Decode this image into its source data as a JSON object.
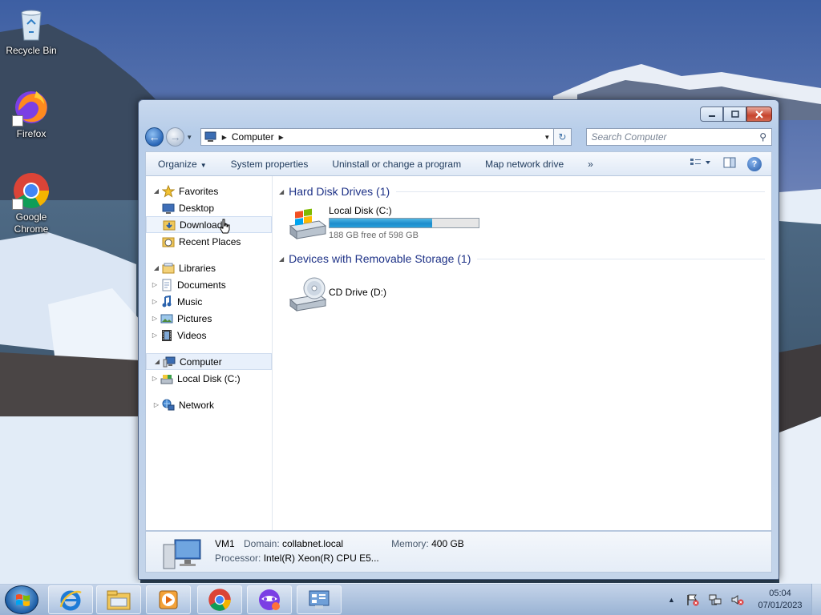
{
  "desktop": {
    "icons": [
      {
        "label": "Recycle Bin",
        "icon": "recycle-bin-icon"
      },
      {
        "label": "Firefox",
        "icon": "firefox-icon"
      },
      {
        "label": "Google Chrome",
        "icon": "chrome-icon"
      }
    ]
  },
  "window": {
    "address": {
      "location": "Computer"
    },
    "search": {
      "placeholder": "Search Computer"
    },
    "commands": {
      "organize": "Organize",
      "system_properties": "System properties",
      "uninstall": "Uninstall or change a program",
      "map_drive": "Map network drive",
      "more": "»"
    },
    "nav": {
      "favorites": "Favorites",
      "desktop": "Desktop",
      "downloads": "Downloads",
      "recent": "Recent Places",
      "libraries": "Libraries",
      "documents": "Documents",
      "music": "Music",
      "pictures": "Pictures",
      "videos": "Videos",
      "computer": "Computer",
      "local_disk": "Local Disk (C:)",
      "network": "Network"
    },
    "groups": {
      "hdd": "Hard Disk Drives (1)",
      "removable": "Devices with Removable Storage (1)"
    },
    "drives": {
      "c_name": "Local Disk (C:)",
      "c_free": "188 GB free of 598 GB",
      "c_used_fraction": 0.686,
      "d_name": "CD Drive (D:)"
    },
    "details": {
      "name": "VM1",
      "domain_label": "Domain:",
      "domain": "collabnet.local",
      "memory_label": "Memory:",
      "memory": "400 GB",
      "processor_label": "Processor:",
      "processor": "Intel(R) Xeon(R) CPU E5..."
    }
  },
  "taskbar": {
    "pinned": [
      "internet-explorer-icon",
      "file-explorer-icon",
      "media-player-icon",
      "chrome-icon",
      "tor-icon",
      "control-panel-icon"
    ],
    "clock": {
      "time": "05:04",
      "date": "07/01/2023"
    }
  }
}
